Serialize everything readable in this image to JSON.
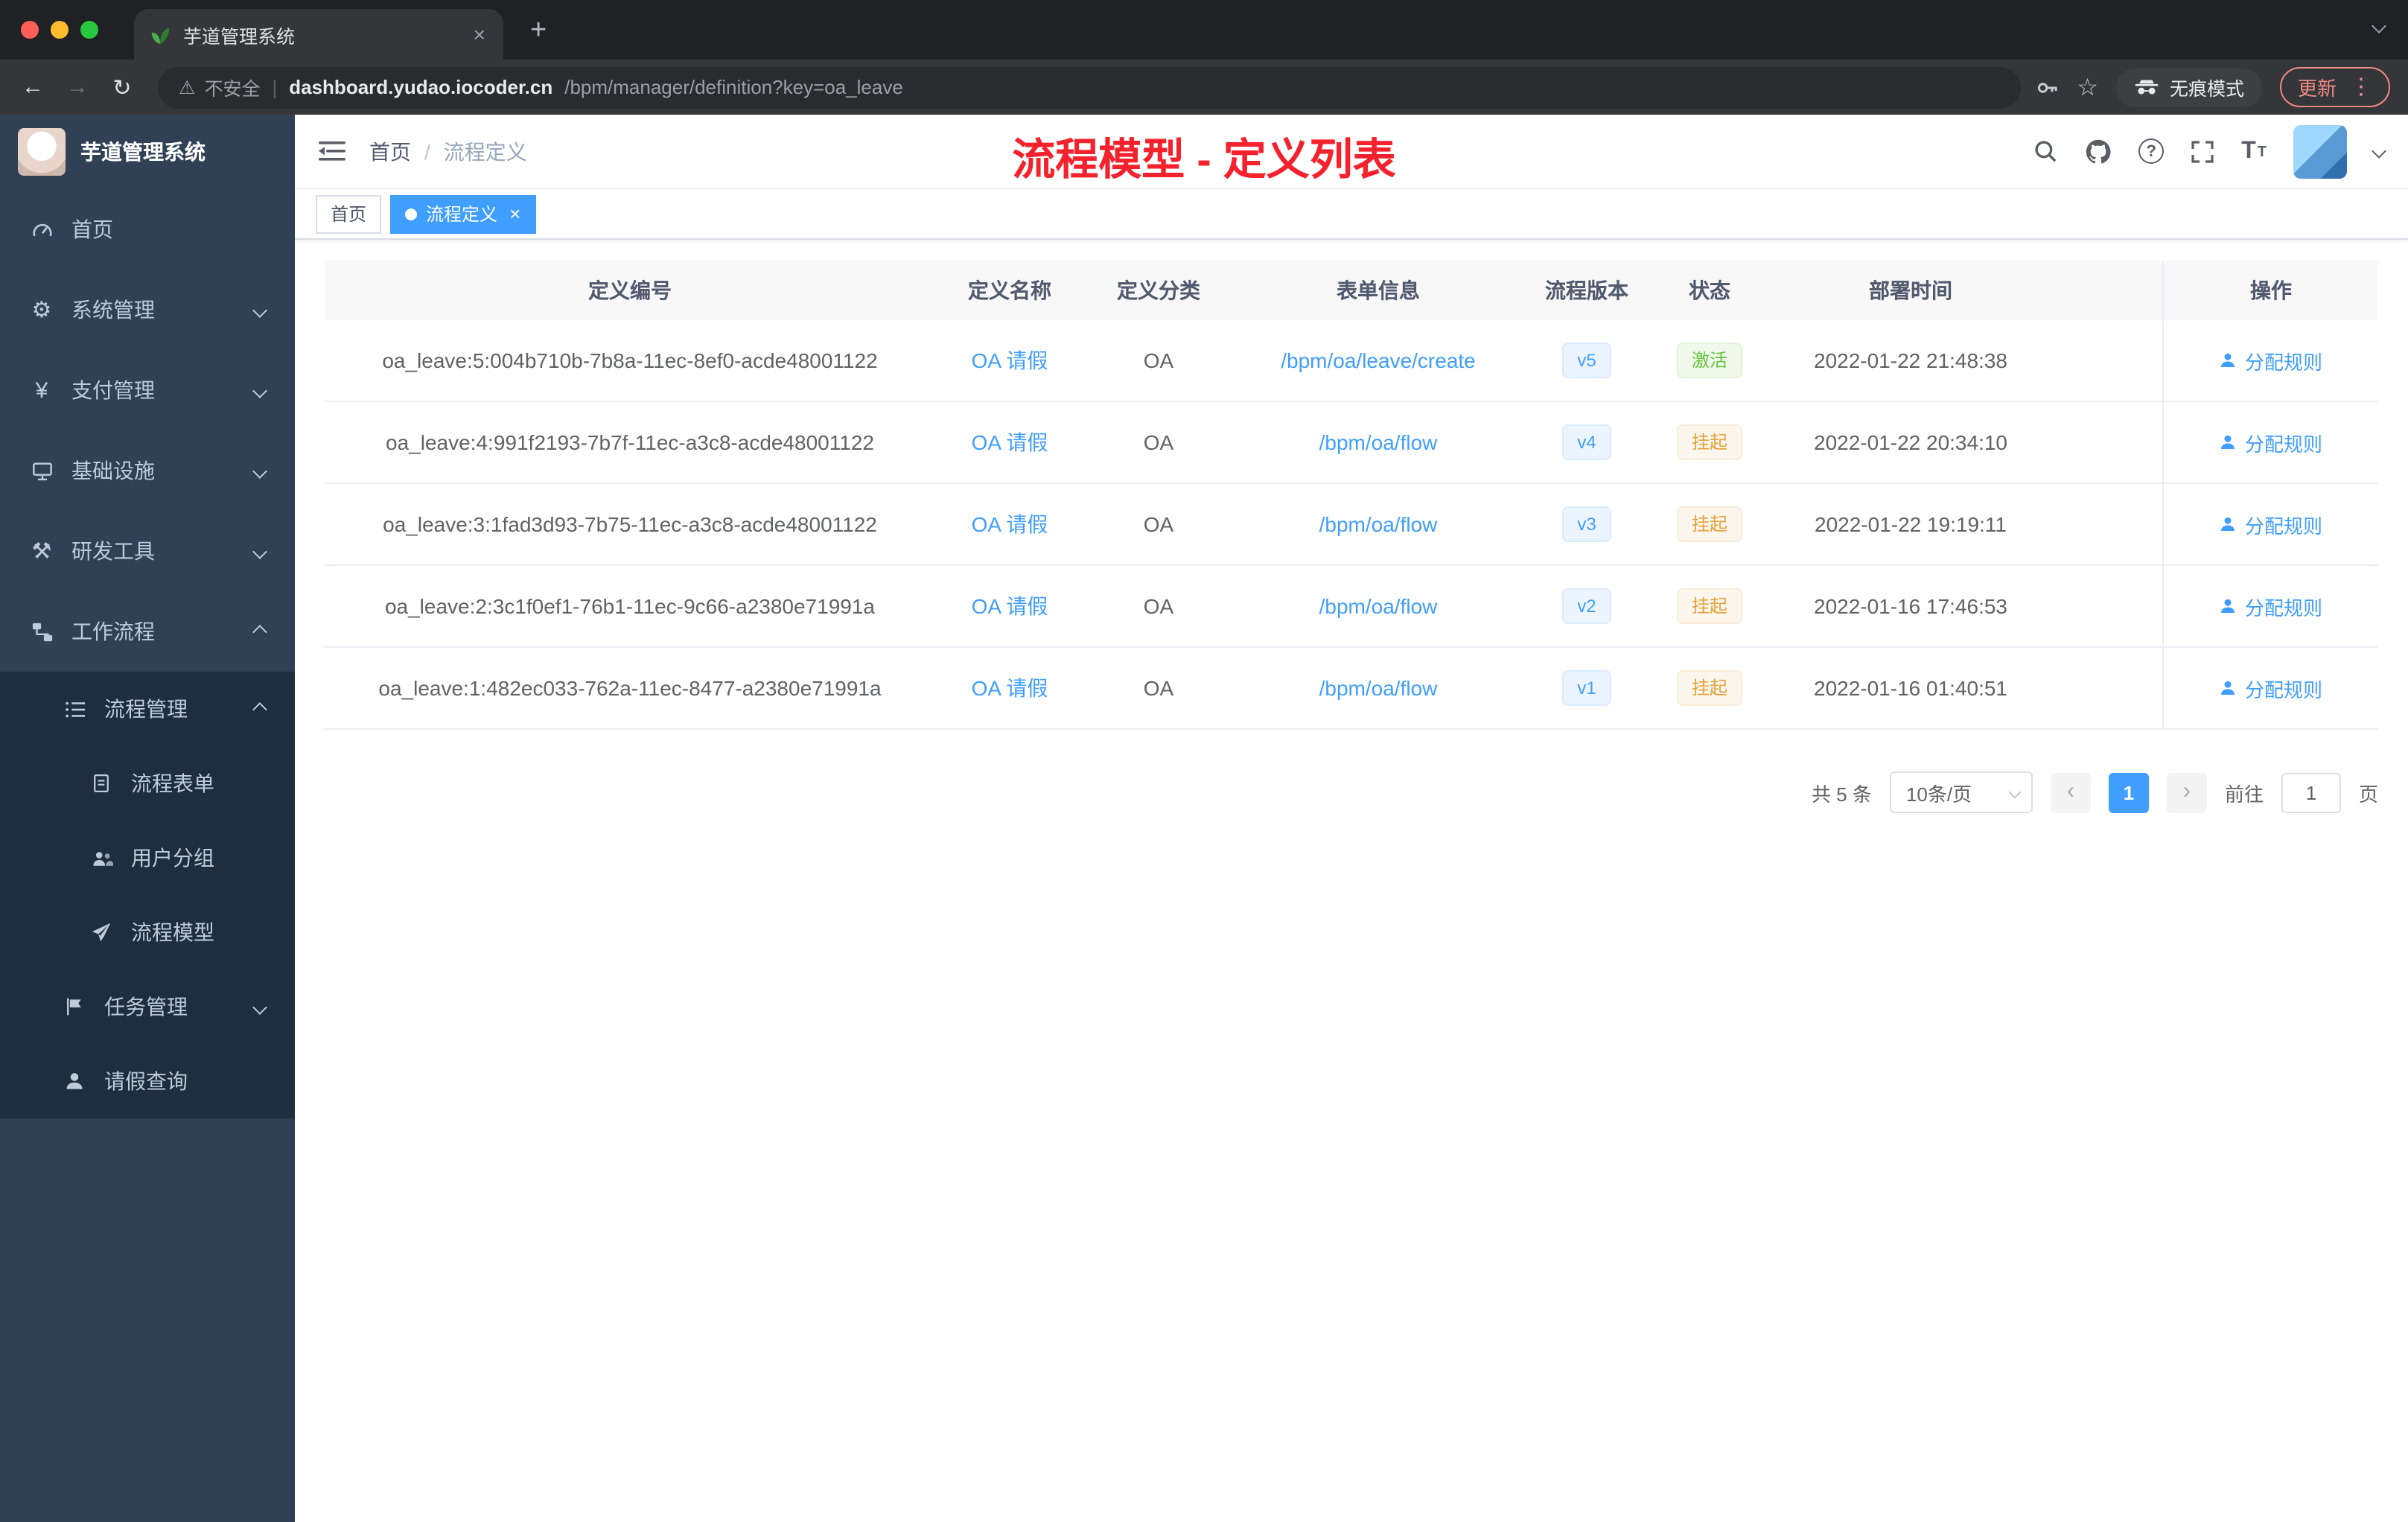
{
  "colors": {
    "accent": "#409eff",
    "annotation_red": "#f5222d",
    "status_active_green": "#67c23a",
    "status_suspended_orange": "#e6a23c",
    "sidebar_bg": "#304156"
  },
  "icons": {
    "settings_gear": "⚙",
    "payment_yen": "¥",
    "dev_tools": "⚒",
    "process_model_plane": "✈",
    "more_vertical": "⋮",
    "star": "☆",
    "warning_triangle": "⚠",
    "new_tab_plus": "+",
    "close": "×",
    "back_arrow": "←",
    "forward_arrow": "→",
    "reload": "↻",
    "question_mark": "?",
    "font_large": "T",
    "font_small": "T",
    "prev_arrow": "‹",
    "next_arrow": "›",
    "url_divider": "|"
  },
  "browser": {
    "tab_title": "芋道管理系统",
    "security_label": "不安全",
    "url_host": "dashboard.yudao.iocoder.cn",
    "url_path": "/bpm/manager/definition?key=oa_leave",
    "incognito_label": "无痕模式",
    "update_label": "更新"
  },
  "sidebar": {
    "logo": "芋道管理系统",
    "items": [
      "首页",
      "系统管理",
      "支付管理",
      "基础设施",
      "研发工具",
      "工作流程",
      "流程管理",
      "流程表单",
      "用户分组",
      "流程模型",
      "任务管理",
      "请假查询"
    ]
  },
  "header": {
    "breadcrumb_home": "首页",
    "breadcrumb_sep": "/",
    "breadcrumb_current": "流程定义",
    "annotation": "流程模型 - 定义列表"
  },
  "tags": {
    "home": "首页",
    "current": "流程定义"
  },
  "table": {
    "columns": [
      "定义编号",
      "定义名称",
      "定义分类",
      "表单信息",
      "流程版本",
      "状态",
      "部署时间",
      "操作"
    ],
    "rows": [
      {
        "id": "oa_leave:5:004b710b-7b8a-11ec-8ef0-acde48001122",
        "name": "OA 请假",
        "category": "OA",
        "form": "/bpm/oa/leave/create",
        "version": "v5",
        "status": "激活",
        "deployed": "2022-01-22 21:48:38",
        "action": "分配规则"
      },
      {
        "id": "oa_leave:4:991f2193-7b7f-11ec-a3c8-acde48001122",
        "name": "OA 请假",
        "category": "OA",
        "form": "/bpm/oa/flow",
        "version": "v4",
        "status": "挂起",
        "deployed": "2022-01-22 20:34:10",
        "action": "分配规则"
      },
      {
        "id": "oa_leave:3:1fad3d93-7b75-11ec-a3c8-acde48001122",
        "name": "OA 请假",
        "category": "OA",
        "form": "/bpm/oa/flow",
        "version": "v3",
        "status": "挂起",
        "deployed": "2022-01-22 19:19:11",
        "action": "分配规则"
      },
      {
        "id": "oa_leave:2:3c1f0ef1-76b1-11ec-9c66-a2380e71991a",
        "name": "OA 请假",
        "category": "OA",
        "form": "/bpm/oa/flow",
        "version": "v2",
        "status": "挂起",
        "deployed": "2022-01-16 17:46:53",
        "action": "分配规则"
      },
      {
        "id": "oa_leave:1:482ec033-762a-11ec-8477-a2380e71991a",
        "name": "OA 请假",
        "category": "OA",
        "form": "/bpm/oa/flow",
        "version": "v1",
        "status": "挂起",
        "deployed": "2022-01-16 01:40:51",
        "action": "分配规则"
      }
    ]
  },
  "pagination": {
    "total": "共 5 条",
    "page_size": "10条/页",
    "current_page": "1",
    "goto_label": "前往",
    "goto_value": "1",
    "page_unit": "页"
  }
}
